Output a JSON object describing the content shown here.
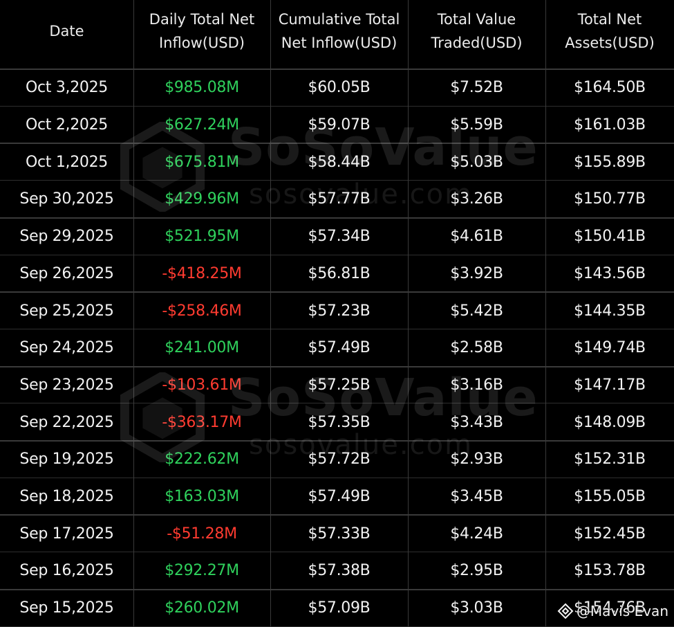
{
  "chart_data": {
    "type": "table",
    "columns": [
      "Date",
      "Daily Total Net Inflow(USD)",
      "Cumulative Total Net Inflow(USD)",
      "Total Value Traded(USD)",
      "Total Net Assets(USD)"
    ],
    "rows": [
      [
        "Oct 3,2025",
        "$985.08M",
        "$60.05B",
        "$7.52B",
        "$164.50B"
      ],
      [
        "Oct 2,2025",
        "$627.24M",
        "$59.07B",
        "$5.59B",
        "$161.03B"
      ],
      [
        "Oct 1,2025",
        "$675.81M",
        "$58.44B",
        "$5.03B",
        "$155.89B"
      ],
      [
        "Sep 30,2025",
        "$429.96M",
        "$57.77B",
        "$3.26B",
        "$150.77B"
      ],
      [
        "Sep 29,2025",
        "$521.95M",
        "$57.34B",
        "$4.61B",
        "$150.41B"
      ],
      [
        "Sep 26,2025",
        "-$418.25M",
        "$56.81B",
        "$3.92B",
        "$143.56B"
      ],
      [
        "Sep 25,2025",
        "-$258.46M",
        "$57.23B",
        "$5.42B",
        "$144.35B"
      ],
      [
        "Sep 24,2025",
        "$241.00M",
        "$57.49B",
        "$2.58B",
        "$149.74B"
      ],
      [
        "Sep 23,2025",
        "-$103.61M",
        "$57.25B",
        "$3.16B",
        "$147.17B"
      ],
      [
        "Sep 22,2025",
        "-$363.17M",
        "$57.35B",
        "$3.43B",
        "$148.09B"
      ],
      [
        "Sep 19,2025",
        "$222.62M",
        "$57.72B",
        "$2.93B",
        "$152.31B"
      ],
      [
        "Sep 18,2025",
        "$163.03M",
        "$57.49B",
        "$3.45B",
        "$155.05B"
      ],
      [
        "Sep 17,2025",
        "-$51.28M",
        "$57.33B",
        "$4.24B",
        "$152.45B"
      ],
      [
        "Sep 16,2025",
        "$292.27M",
        "$57.38B",
        "$2.95B",
        "$153.78B"
      ],
      [
        "Sep 15,2025",
        "$260.02M",
        "$57.09B",
        "$3.03B",
        "$154.76B"
      ]
    ]
  },
  "colors": {
    "background": "#000000",
    "text": "#f2f2f2",
    "inflow_positive": "#2fd15c",
    "inflow_negative": "#ff3b30",
    "grid": "#3a3a3a"
  },
  "watermark": {
    "brand": "SoSoValue",
    "site": "sosovalue.com",
    "logo_icon": "sosovalue-logo-icon"
  },
  "credit": {
    "text": "@Mavis Evan",
    "icon": "binance-diamond-icon"
  }
}
